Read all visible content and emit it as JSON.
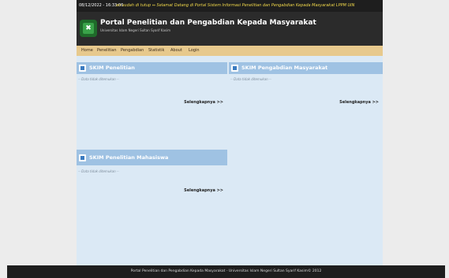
{
  "topbar": {
    "datetime": "08/12/2022 - 16:33:06",
    "marquee": "an sudah di tutup ⇔ Selamat Datang di Portal Sistem Informasi Penelitian dan Pengabdian Kepada Masyarakat LPPM UIN"
  },
  "header": {
    "logo_glyph": "✖",
    "title": "Portal Penelitian dan Pengabdian Kepada Masyarakat",
    "subtitle": "Universitas Islam Negeri Sultan Syarif Kasim"
  },
  "nav": {
    "items": [
      "Home",
      "Penelitian",
      "Pengabdian",
      "Statistik",
      "About",
      "Login"
    ]
  },
  "panels": {
    "penelitian": {
      "title": "SKIM Penelitian",
      "empty": "-- Data tidak ditemukan --",
      "more": "Selengkapnya >>"
    },
    "pengabdian": {
      "title": "SKIM Pengabdian Masyarakat",
      "empty": "-- Data tidak ditemukan --",
      "more": "Selengkapnya >>"
    },
    "mahasiswa": {
      "title": "SKIM Penelitian Mahasiswa",
      "empty": "-- Data tidak ditemukan --",
      "more": "Selengkapnya >>"
    }
  },
  "footer": {
    "text": "Portal Penelitian dan Pengabdian Kepada Masyarakat - Universitas Islam Negeri Sultan Syarif Kasim© 2012"
  },
  "colors": {
    "page_bg": "#dbe9f5",
    "panel_header": "#9fc2e3",
    "nav_bg": "#e7c98d",
    "header_bg": "#2b2b2b"
  }
}
